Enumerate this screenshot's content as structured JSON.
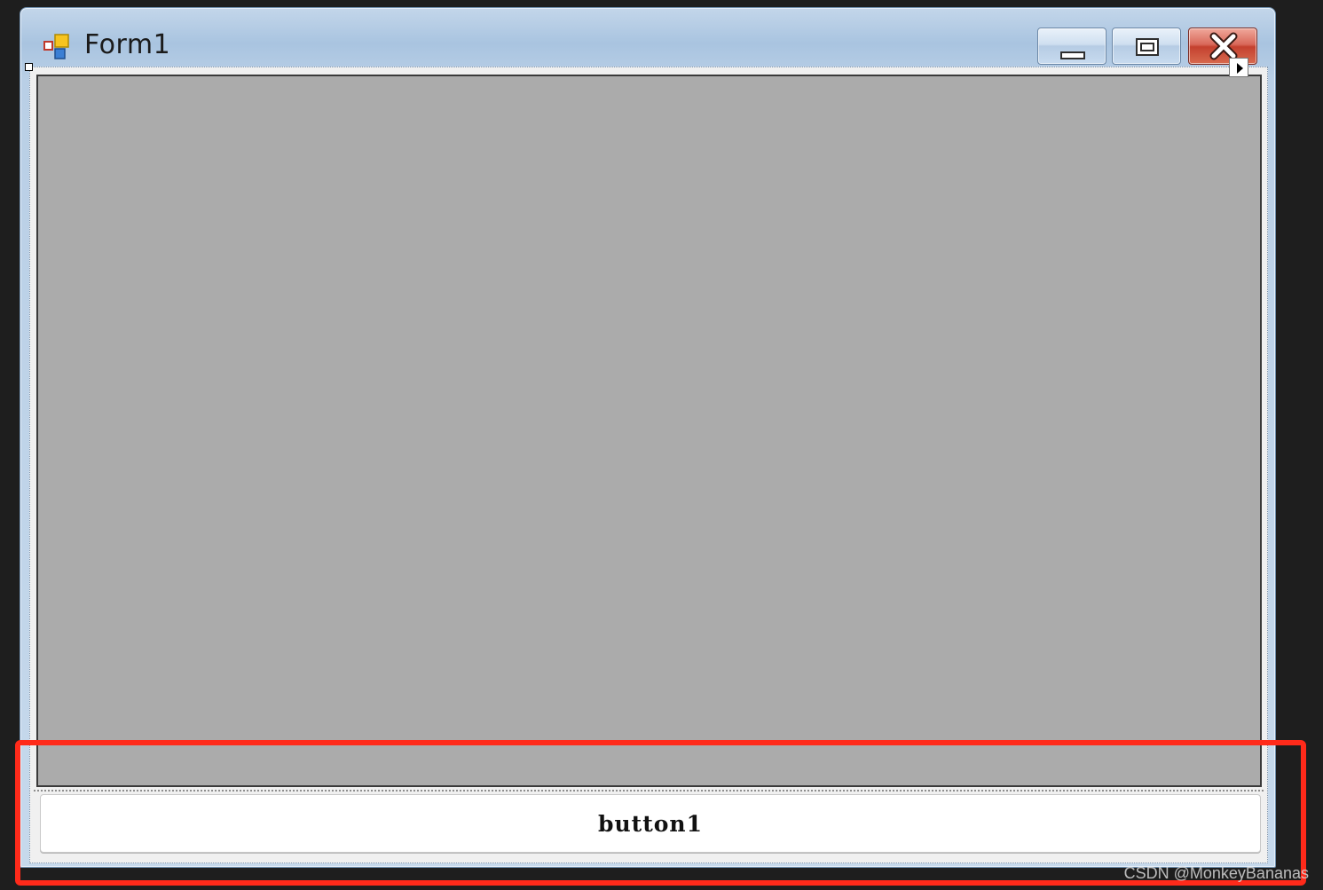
{
  "window": {
    "title": "Form1",
    "caption_buttons": {
      "minimize_icon": "minimize-icon",
      "maximize_icon": "maximize-icon",
      "close_icon": "close-icon"
    },
    "accent_close": "#d9695a"
  },
  "designer": {
    "panel_color": "#ababab",
    "button1_label": "button1"
  },
  "annotation": {
    "highlight_color": "#ff2a1a"
  },
  "watermark": "CSDN @MonkeyBananas"
}
